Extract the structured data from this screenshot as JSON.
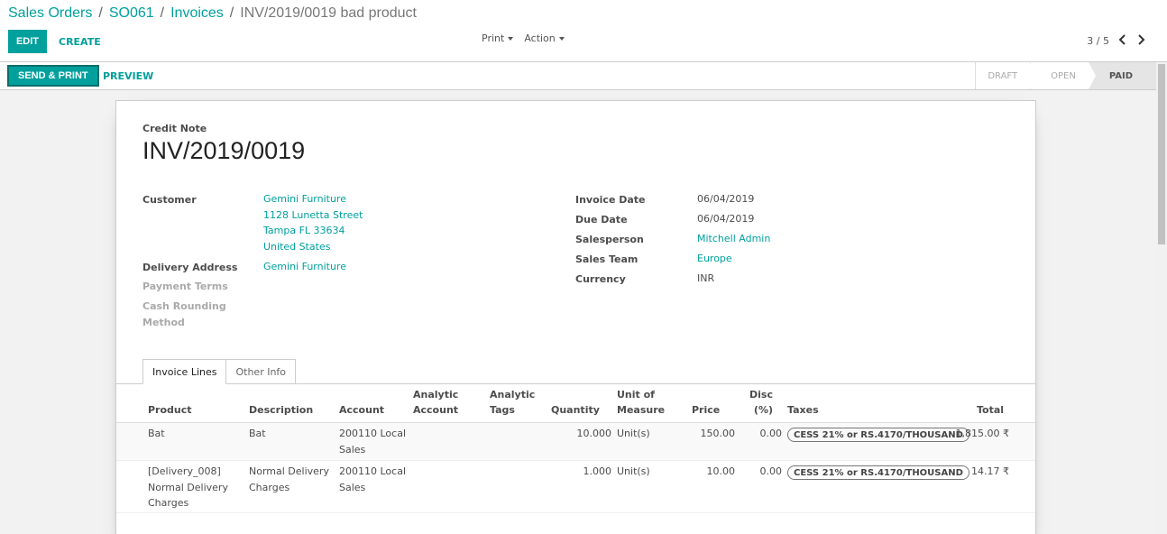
{
  "breadcrumb": {
    "items": [
      "Sales Orders",
      "SO061",
      "Invoices"
    ],
    "current": "INV/2019/0019 bad product",
    "separator": "/"
  },
  "toolbar": {
    "edit_label": "EDIT",
    "create_label": "CREATE",
    "print_label": "Print",
    "action_label": "Action"
  },
  "pager": {
    "value": "3 / 5",
    "prev_icon": "chevron-left",
    "next_icon": "chevron-right"
  },
  "header": {
    "send_print_label": "SEND & PRINT",
    "preview_label": "PREVIEW",
    "stages": [
      "DRAFT",
      "OPEN",
      "PAID"
    ],
    "current_stage": "PAID"
  },
  "form": {
    "doc_type": "Credit Note",
    "doc_name": "INV/2019/0019",
    "customer_label": "Customer",
    "customer_name": "Gemini Furniture",
    "customer_street": "1128 Lunetta Street",
    "customer_city": "Tampa FL 33634",
    "customer_country": "United States",
    "delivery_label": "Delivery Address",
    "delivery_value": "Gemini Furniture",
    "payment_terms_label": "Payment Terms",
    "cash_rounding_label_1": "Cash Rounding",
    "cash_rounding_label_2": "Method",
    "invoice_date_label": "Invoice Date",
    "invoice_date": "06/04/2019",
    "due_date_label": "Due Date",
    "due_date": "06/04/2019",
    "salesperson_label": "Salesperson",
    "salesperson": "Mitchell Admin",
    "sales_team_label": "Sales Team",
    "sales_team": "Europe",
    "currency_label": "Currency",
    "currency": "INR"
  },
  "tabs": [
    "Invoice Lines",
    "Other Info"
  ],
  "table": {
    "headers": {
      "product": "Product",
      "description": "Description",
      "account": "Account",
      "analytic_account_1": "Analytic",
      "analytic_account_2": "Account",
      "analytic_tags_1": "Analytic",
      "analytic_tags_2": "Tags",
      "quantity": "Quantity",
      "uom_1": "Unit of",
      "uom_2": "Measure",
      "price": "Price",
      "disc_1": "Disc",
      "disc_2": "(%)",
      "taxes": "Taxes",
      "total": "Total"
    },
    "rows": [
      {
        "product": [
          "Bat"
        ],
        "description": [
          "Bat"
        ],
        "account": [
          "200110 Local",
          "Sales"
        ],
        "quantity": "10.000",
        "uom": "Unit(s)",
        "price": "150.00",
        "disc": "0.00",
        "tax": "CESS 21% or RS.4170/THOUSAND",
        "total": "1,815.00 ₹"
      },
      {
        "product": [
          "[Delivery_008]",
          "Normal Delivery",
          "Charges"
        ],
        "description": [
          "Normal Delivery",
          "Charges"
        ],
        "account": [
          "200110 Local",
          "Sales"
        ],
        "quantity": "1.000",
        "uom": "Unit(s)",
        "price": "10.00",
        "disc": "0.00",
        "tax": "CESS 21% or RS.4170/THOUSAND",
        "total": "14.17 ₹"
      }
    ]
  },
  "colors": {
    "accent": "#00a09d",
    "accent_dark": "#0b6e6b"
  }
}
